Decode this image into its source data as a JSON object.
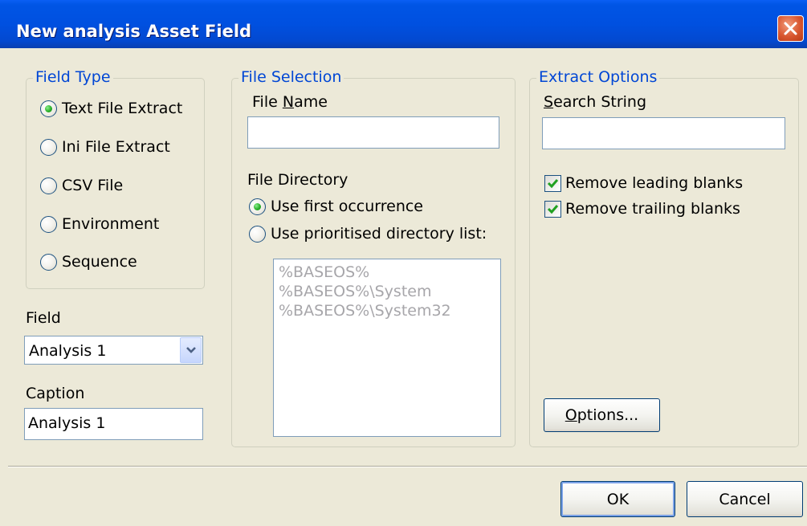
{
  "window": {
    "title": "New analysis Asset Field",
    "close_symbol": "×"
  },
  "field_type": {
    "legend": "Field Type",
    "options": [
      {
        "label": "Text File Extract",
        "checked": true
      },
      {
        "label": "Ini File Extract",
        "checked": false
      },
      {
        "label": "CSV File",
        "checked": false
      },
      {
        "label": "Environment",
        "checked": false
      },
      {
        "label": "Sequence",
        "checked": false
      }
    ]
  },
  "field": {
    "label": "Field",
    "value": "Analysis 1"
  },
  "caption": {
    "label": "Caption",
    "value": "Analysis 1"
  },
  "file_selection": {
    "legend": "File Selection",
    "file_name_label_pre": "File ",
    "file_name_label_mnemonic": "N",
    "file_name_label_post": "ame",
    "file_name_value": "",
    "file_directory_label": "File Directory",
    "options": [
      {
        "label": "Use first occurrence",
        "checked": true
      },
      {
        "label": "Use prioritised directory list:",
        "checked": false
      }
    ],
    "directory_list": [
      "%BASEOS%",
      "%BASEOS%\\System",
      "%BASEOS%\\System32"
    ]
  },
  "extract_options": {
    "legend": "Extract Options",
    "search_label_mnemonic": "S",
    "search_label_rest": "earch String",
    "search_value": "",
    "checkboxes": [
      {
        "label": "Remove leading blanks",
        "checked": true
      },
      {
        "label": "Remove trailing blanks",
        "checked": true
      }
    ],
    "options_button_mnemonic": "O",
    "options_button_rest": "ptions..."
  },
  "footer": {
    "ok_label": "OK",
    "cancel_label": "Cancel"
  },
  "colors": {
    "titlebar": "#0050e0",
    "dialog_bg": "#ece9d8",
    "legend_text": "#0046d5",
    "radio_dot": "#2bb02b",
    "check_mark": "#21a121"
  }
}
